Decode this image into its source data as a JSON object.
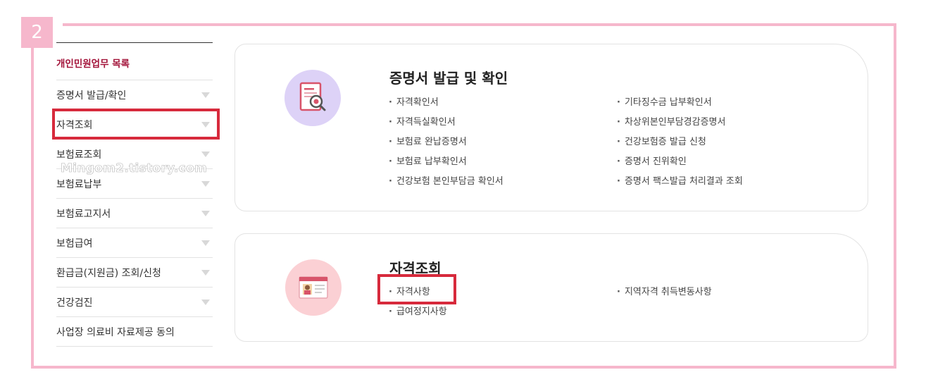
{
  "step_badge": "2",
  "watermark": "Mingom2.tistory.com",
  "sidebar": {
    "heading": "개인민원업무 목록",
    "items": [
      {
        "label": "증명서 발급/확인",
        "expandable": true
      },
      {
        "label": "자격조회",
        "expandable": true
      },
      {
        "label": "보험료조회",
        "expandable": true
      },
      {
        "label": "보험료납부",
        "expandable": true
      },
      {
        "label": "보험료고지서",
        "expandable": true
      },
      {
        "label": "보험급여",
        "expandable": true
      },
      {
        "label": "환급금(지원금) 조회/신청",
        "expandable": true
      },
      {
        "label": "건강검진",
        "expandable": true
      },
      {
        "label": "사업장 의료비 자료제공 동의",
        "expandable": false
      }
    ]
  },
  "cards": [
    {
      "title": "증명서 발급 및 확인",
      "icon": "certificate-search-icon",
      "left": [
        "자격확인서",
        "자격득실확인서",
        "보험료 완납증명서",
        "보험료 납부확인서",
        "건강보험 본인부담금 확인서"
      ],
      "right": [
        "기타징수금 납부확인서",
        "차상위본인부담경감증명서",
        "건강보험증 발급 신청",
        "증명서 진위확인",
        "증명서 팩스발급 처리결과 조회"
      ]
    },
    {
      "title": "자격조회",
      "icon": "id-card-icon",
      "left": [
        "자격사항",
        "급여정지사항"
      ],
      "right": [
        "지역자격 취득변동사항"
      ]
    }
  ],
  "colors": {
    "frame": "#f6b7cc",
    "highlight": "#d72a3c",
    "sidebar_heading": "#a3153b",
    "icon_bg_1": "#ddd2f7",
    "icon_bg_2": "#fbd0d4"
  }
}
